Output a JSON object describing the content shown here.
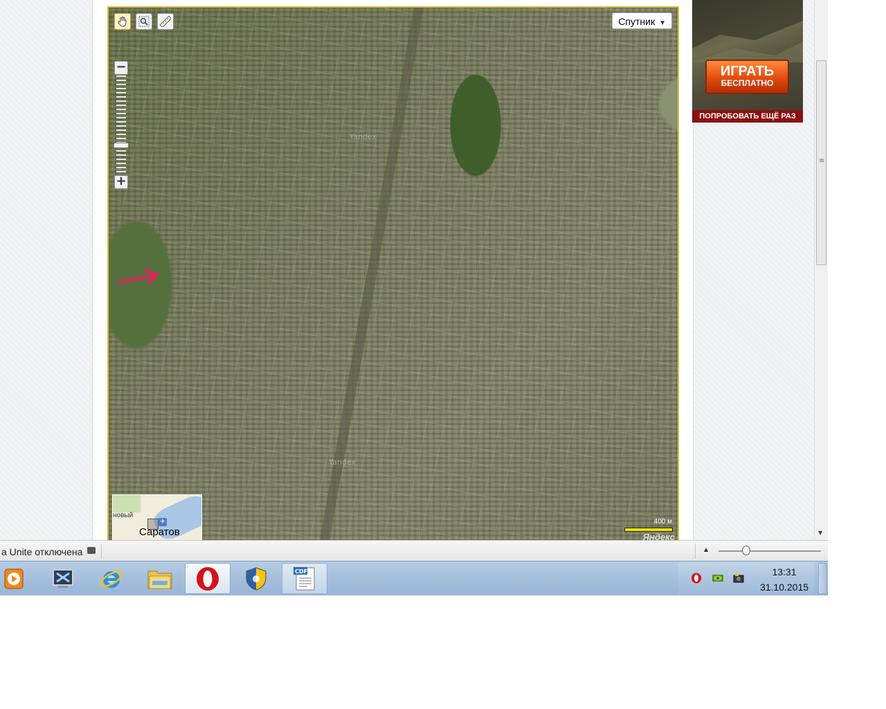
{
  "map": {
    "layer_select": "Спутник",
    "watermark": "Yandex",
    "scale_label": "400 м",
    "logo": "Яндекс",
    "minimap_city": "Саратов",
    "minimap_cut_label": "новый",
    "tools": [
      "hand-icon",
      "magnifier-icon",
      "ruler-icon"
    ]
  },
  "ad": {
    "button_line1": "ИГРАТЬ",
    "button_line2": "БЕСПЛАТНО",
    "strip": "ПОПРОБОВАТЬ ЕЩЁ РАЗ"
  },
  "statusbar": {
    "text": "a Unite отключена"
  },
  "taskbar": {
    "items": [
      {
        "icon": "media-player-icon",
        "state": "normal"
      },
      {
        "icon": "remote-terminal-icon",
        "state": "normal"
      },
      {
        "icon": "internet-explorer-icon",
        "state": "normal"
      },
      {
        "icon": "folder-icon",
        "state": "normal"
      },
      {
        "icon": "opera-icon",
        "state": "active"
      },
      {
        "icon": "shield-icon",
        "state": "normal"
      },
      {
        "icon": "cdf-document-icon",
        "state": "open"
      }
    ],
    "tray": [
      "opera-tray-icon",
      "nvidia-icon",
      "camera-tray-icon"
    ],
    "time": "13:31",
    "date": "31.10.2015"
  },
  "colors": {
    "map_border": "#e3b93a",
    "ad_button": "#e24a0e",
    "ad_strip": "#8c1010",
    "annotation_arrow": "#e8205a"
  }
}
